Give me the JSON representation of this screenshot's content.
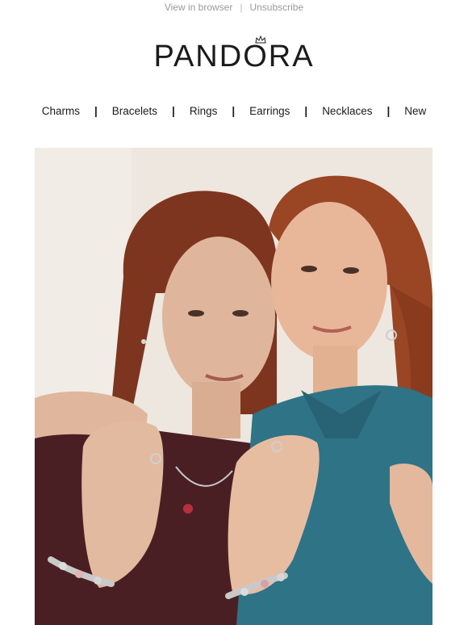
{
  "header": {
    "view_in_browser": "View in browser",
    "divider": "|",
    "unsubscribe": "Unsubscribe"
  },
  "brand": {
    "logo_text": "PANDORA",
    "logo_icon": "crown-icon"
  },
  "nav": {
    "items": [
      {
        "label": "Charms"
      },
      {
        "label": "Bracelets"
      },
      {
        "label": "Rings"
      },
      {
        "label": "Earrings"
      },
      {
        "label": "Necklaces"
      },
      {
        "label": "New"
      }
    ],
    "separator": "|"
  },
  "hero": {
    "image": "hero-photo-two-women-wearing-jewelry"
  },
  "colors": {
    "text": "#1b1b1b",
    "muted": "#9a9a9a",
    "hero_background": "#ece6de",
    "teal_shirt": "#2f7387",
    "burgundy_top": "#4a1f24",
    "hair_auburn": "#8b3a1f"
  }
}
